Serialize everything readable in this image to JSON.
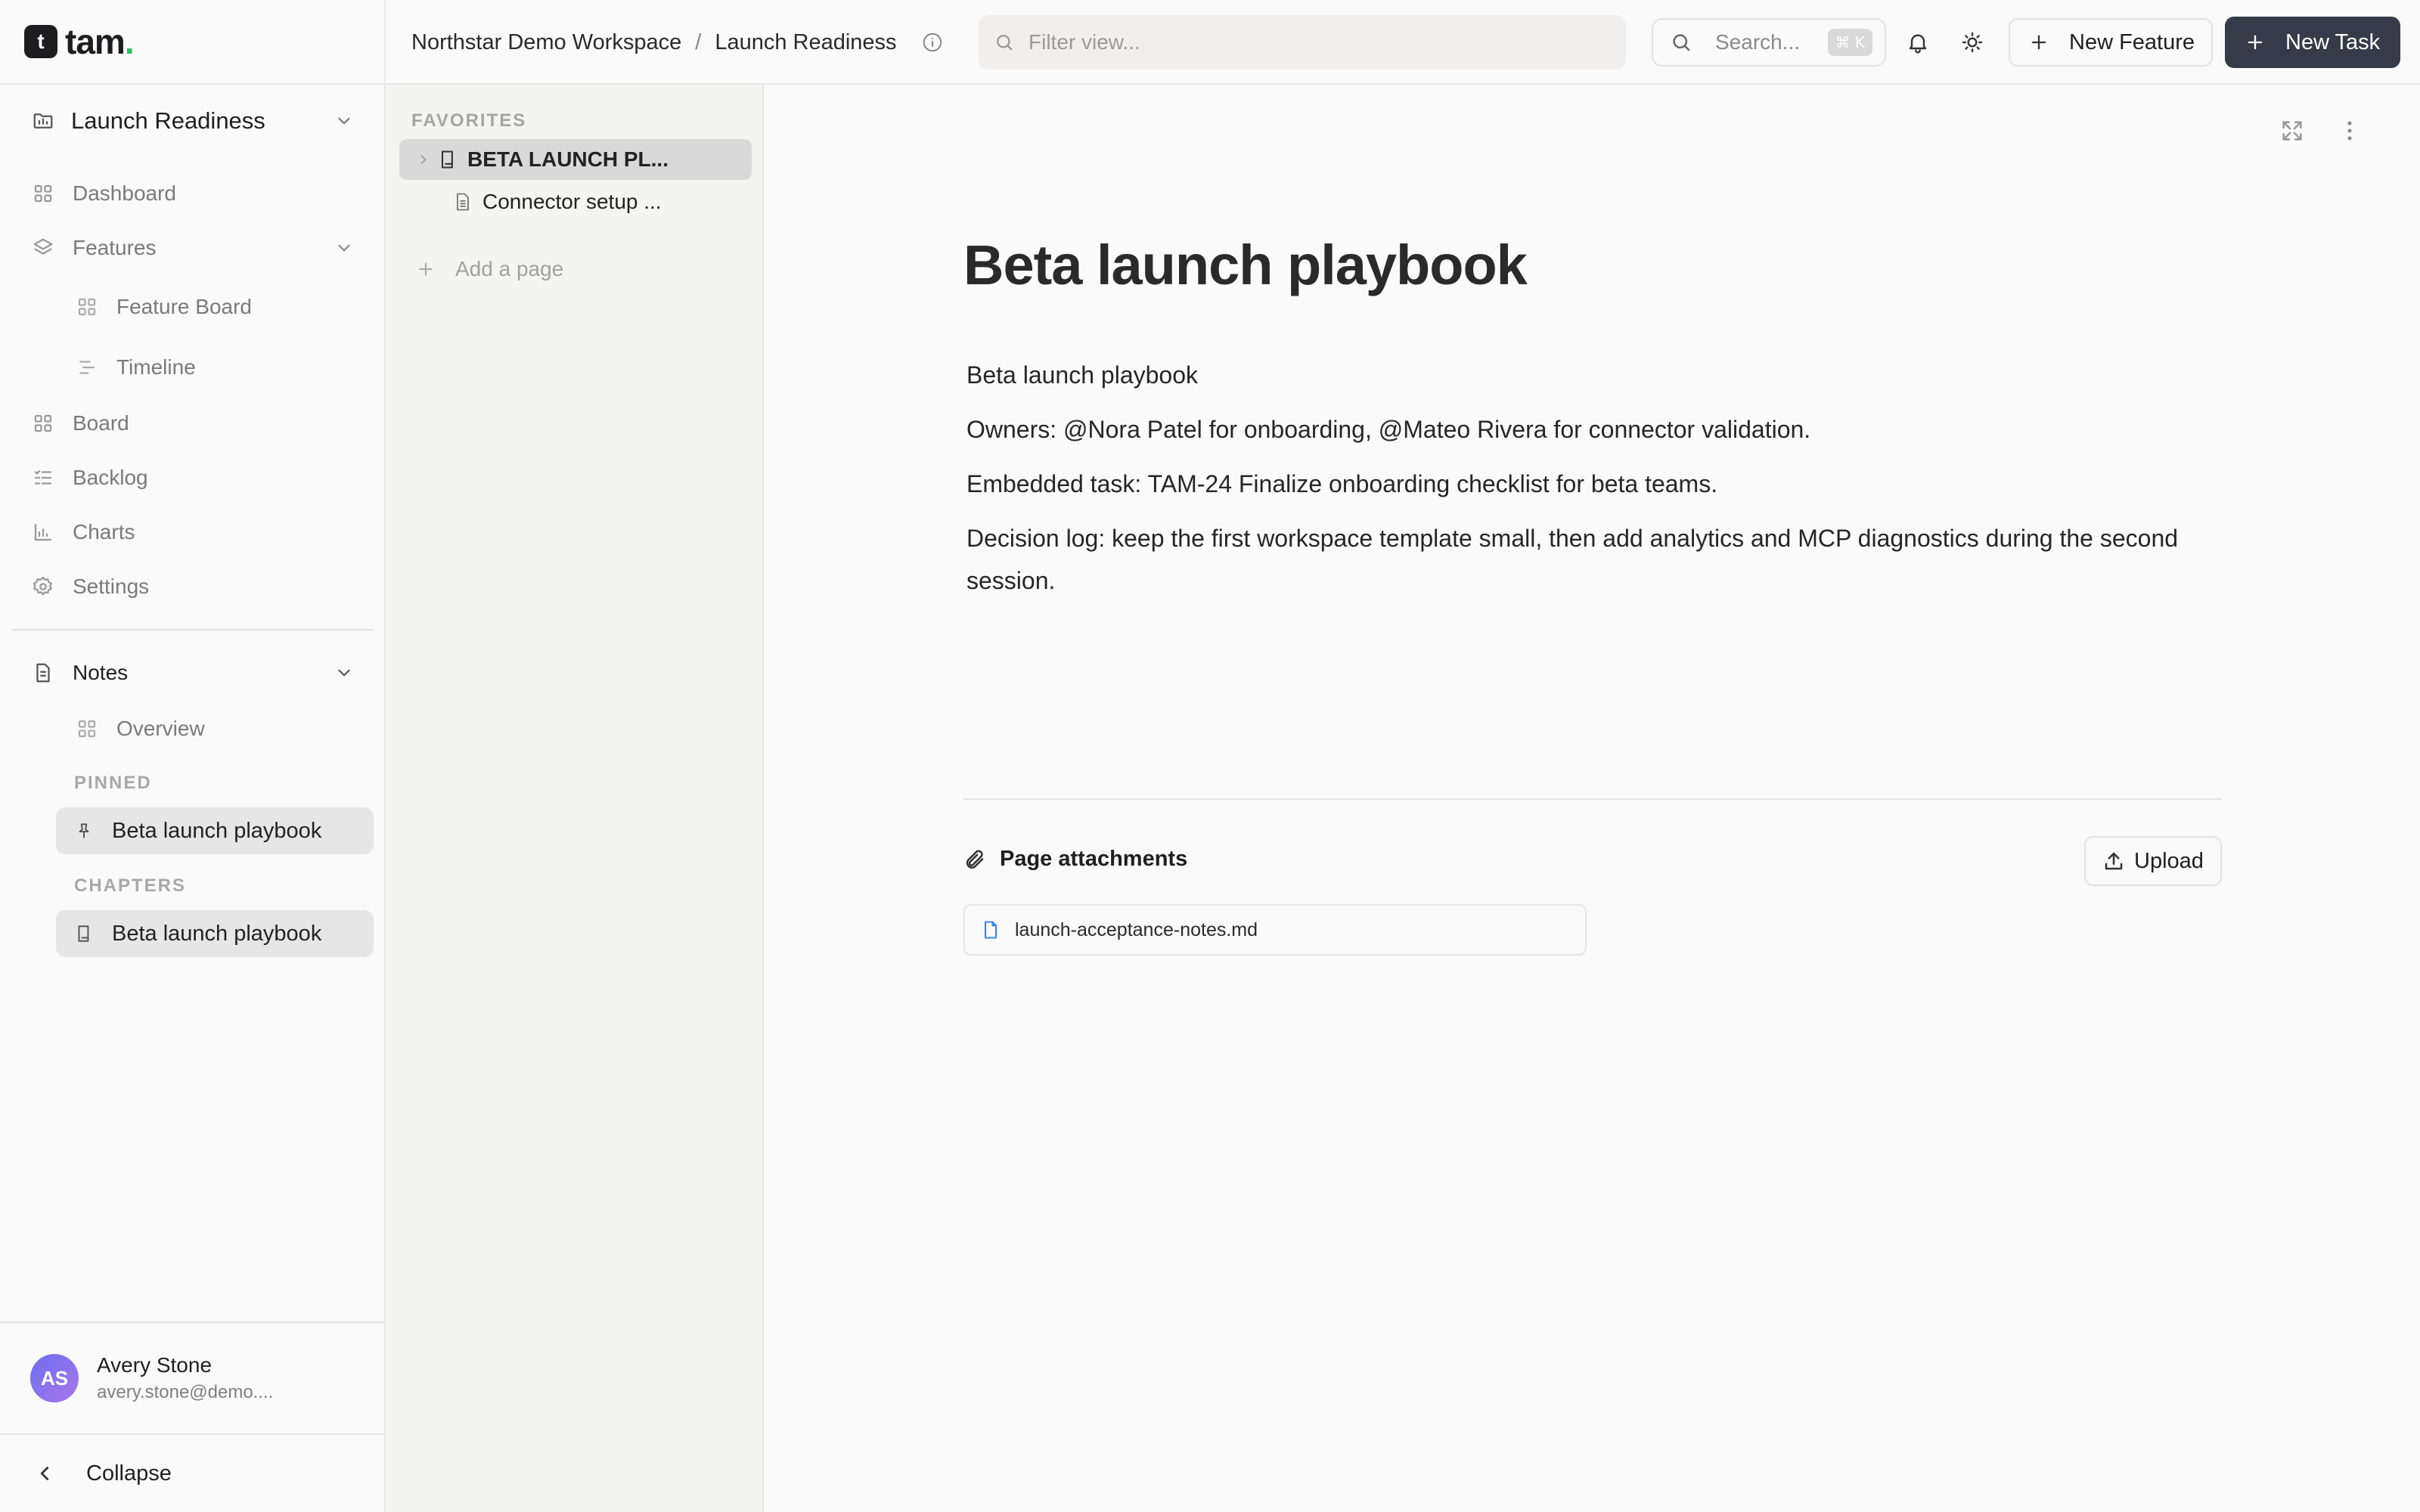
{
  "app": {
    "logo_letter": "t",
    "logo_name": "tam",
    "logo_dot": "."
  },
  "sidebar": {
    "project": "Launch Readiness",
    "nav": {
      "dashboard": "Dashboard",
      "features": "Features",
      "feature_board": "Feature Board",
      "timeline": "Timeline",
      "board": "Board",
      "backlog": "Backlog",
      "charts": "Charts",
      "settings": "Settings"
    },
    "notes": {
      "title": "Notes",
      "overview": "Overview",
      "pinned_label": "PINNED",
      "pinned_item": "Beta launch playbook",
      "chapters_label": "CHAPTERS",
      "chapter_item": "Beta launch playbook"
    },
    "user": {
      "initials": "AS",
      "name": "Avery Stone",
      "email": "avery.stone@demo...."
    },
    "collapse_label": "Collapse"
  },
  "topbar": {
    "breadcrumb": {
      "workspace": "Northstar Demo Workspace",
      "separator": "/",
      "page": "Launch Readiness"
    },
    "filter_placeholder": "Filter view...",
    "search_placeholder": "Search...",
    "search_shortcut": "⌘ K",
    "new_feature_label": "New Feature",
    "new_task_label": "New Task"
  },
  "tree": {
    "favorites_label": "FAVORITES",
    "items": [
      {
        "label": "BETA LAUNCH PL..."
      },
      {
        "label": "Connector setup ..."
      }
    ],
    "add_page_label": "Add a page"
  },
  "document": {
    "title": "Beta launch playbook",
    "paragraphs": [
      "Beta launch playbook",
      "Owners: @Nora Patel for onboarding, @Mateo Rivera for connector validation.",
      "Embedded task: TAM-24 Finalize onboarding checklist for beta teams.",
      "Decision log: keep the first workspace template small, then add analytics and MCP diagnostics during the second session."
    ],
    "attachments": {
      "title": "Page attachments",
      "upload_label": "Upload",
      "files": [
        {
          "name": "launch-acceptance-notes.md"
        }
      ]
    }
  },
  "colors": {
    "accent_dark": "#363b49",
    "logo_dot": "#22c55e",
    "avatar_from": "#6c6cf0",
    "avatar_to": "#a779e9",
    "file_icon": "#3b82f6"
  }
}
